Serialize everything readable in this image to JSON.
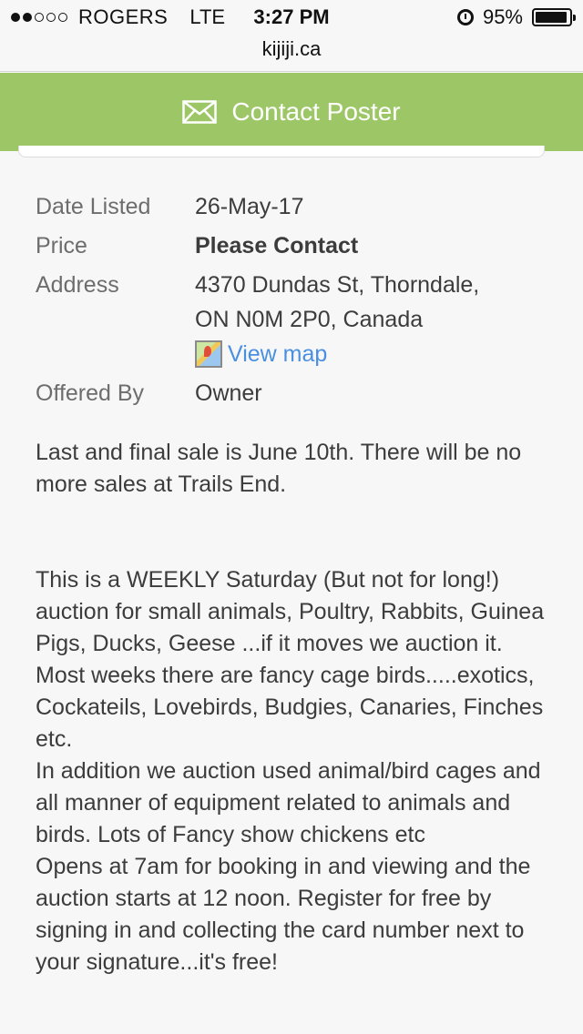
{
  "status_bar": {
    "carrier": "ROGERS",
    "network": "LTE",
    "time": "3:27 PM",
    "battery": "95%",
    "battery_level": 0.95,
    "signal_bars_filled": 2,
    "signal_bars_total": 5
  },
  "url_bar": {
    "domain": "kijiji.ca"
  },
  "contact": {
    "label": "Contact Poster",
    "icon": "mail-icon",
    "color": "#9dc766"
  },
  "details": {
    "date_listed": {
      "label": "Date Listed",
      "value": "26-May-17"
    },
    "price": {
      "label": "Price",
      "value": "Please Contact"
    },
    "address": {
      "label": "Address",
      "line1": "4370 Dundas St, Thorndale,",
      "line2": "ON N0M 2P0, Canada",
      "map_link": "View map"
    },
    "offered_by": {
      "label": "Offered By",
      "value": "Owner"
    }
  },
  "description": {
    "paragraph1": "Last and final sale is June 10th. There will be no more sales at Trails End.",
    "paragraph2": "This is a WEEKLY Saturday (But not for long!) auction for small animals, Poultry, Rabbits, Guinea Pigs, Ducks, Geese ...if it moves we auction it. Most weeks there are fancy cage birds.....exotics, Cockateils, Lovebirds, Budgies, Canaries, Finches etc.",
    "paragraph3": "In addition we auction used animal/bird cages and all manner of equipment related to animals and birds. Lots of Fancy show chickens etc",
    "paragraph4": "Opens at 7am for booking in and viewing and the auction starts at 12 noon. Register for free by signing in and collecting the card number next to your signature...it's free!"
  },
  "colors": {
    "accent": "#9dc766",
    "link": "#4a8fe0"
  }
}
